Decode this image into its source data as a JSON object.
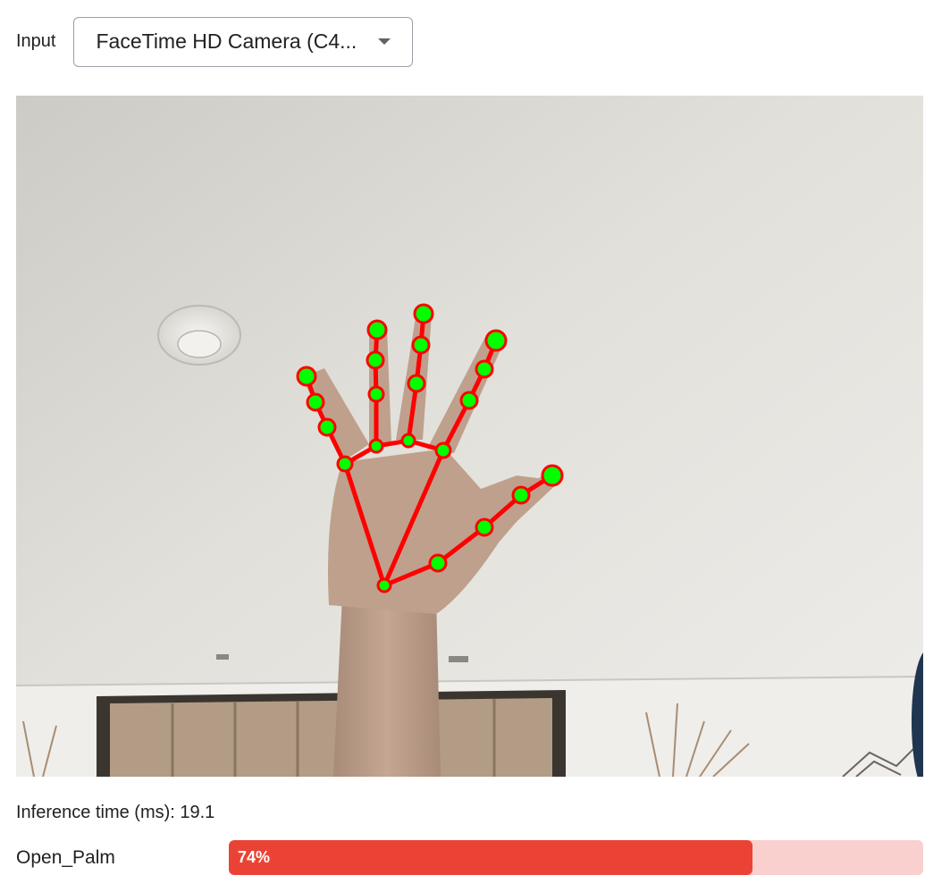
{
  "input": {
    "label": "Input",
    "selected_camera": "FaceTime HD Camera (C4...",
    "dropdown_icon": "caret-down-icon"
  },
  "video": {
    "description_icon": "camera-feed",
    "landmark_color": "#00ff00",
    "connection_color": "#ff0000"
  },
  "stats": {
    "inference_label": "Inference time (ms): 19.1"
  },
  "gesture": {
    "name": "Open_Palm",
    "score_text": "74%",
    "score_fraction": 0.754,
    "bar_color": "#ea4335",
    "track_color": "#f9d0cd"
  }
}
